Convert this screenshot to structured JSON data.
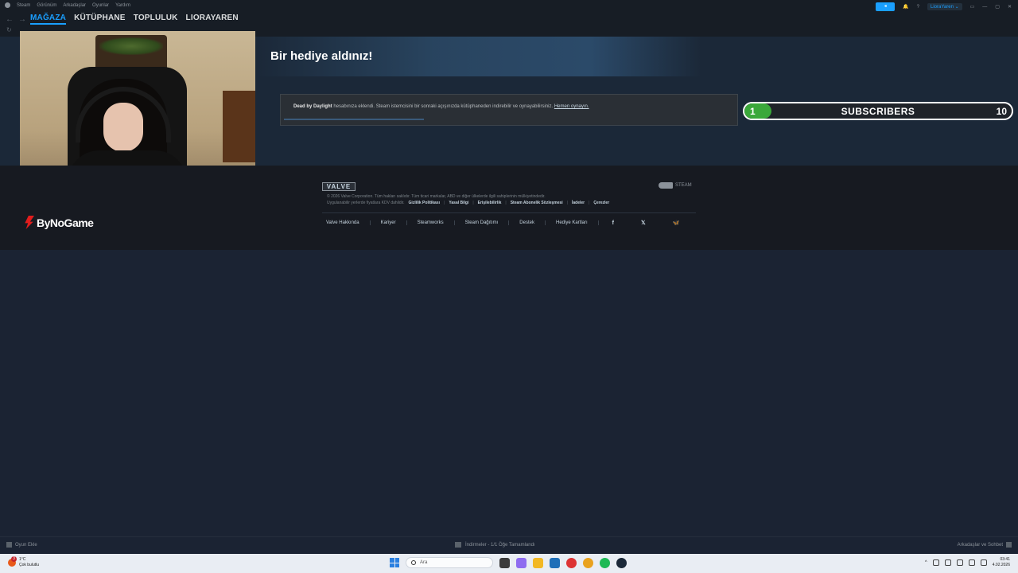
{
  "menu": {
    "items": [
      "Steam",
      "Görünüm",
      "Arkadaşlar",
      "Oyunlar",
      "Yardım"
    ]
  },
  "titlebar": {
    "user": "LioraYaren",
    "help": "?",
    "window_controls": [
      "—",
      "▢",
      "✕"
    ]
  },
  "nav": {
    "tabs": [
      "MAĞAZA",
      "KÜTÜPHANE",
      "TOPLULUK",
      "LIORAYAREN"
    ],
    "active_tab": "MAĞAZA"
  },
  "gift": {
    "title": "Bir hediye aldınız!",
    "game": "Dead by Daylight",
    "message": " hesabınıza eklendi. Steam istemcisini bir sonraki açışınızda kütüphaneden indirebilir ve oynayabilirsiniz. ",
    "link": "Hemen oynayın."
  },
  "subscribers": {
    "current": "1",
    "label": "SUBSCRIBERS",
    "goal": "10",
    "progress_fraction": 0.1,
    "fill_color": "#3aa83a"
  },
  "footer": {
    "valve_logo": "VALVE",
    "steam_logo": "STEAM",
    "copyright": "© 2026 Valve Corporation. Tüm hakları saklıdır. Tüm ticari markalar, ABD ve diğer ülkelerde ilgili sahiplerinin mülkiyetindedir.",
    "vat_note": "Uygulanabilir yerlerde fiyatlara KDV dahildir.",
    "legal_links": [
      "Gizlilik Politikası",
      "Yasal Bilgi",
      "Erişilebilirlik",
      "Steam Abonelik Sözleşmesi",
      "İadeler",
      "Çerezler"
    ],
    "links": [
      "Valve Hakkında",
      "Kariyer",
      "Steamworks",
      "Steam Dağıtımı",
      "Destek",
      "Hediye Kartları"
    ],
    "social": [
      "f",
      "𝕏",
      "🦋"
    ]
  },
  "overlay": {
    "brand": "ByNoGame"
  },
  "bottombar": {
    "add_game": "Oyun Ekle",
    "downloads": "İndirmeler - 1/1 Öğe Tamamlandı",
    "friends": "Arkadaşlar ve Sohbet"
  },
  "taskbar": {
    "weather_temp": "1°C",
    "weather_desc": "Çok bulutlu",
    "weather_badge": "3",
    "search_placeholder": "Ara",
    "time": "03:41",
    "date": "4.02.2026"
  }
}
